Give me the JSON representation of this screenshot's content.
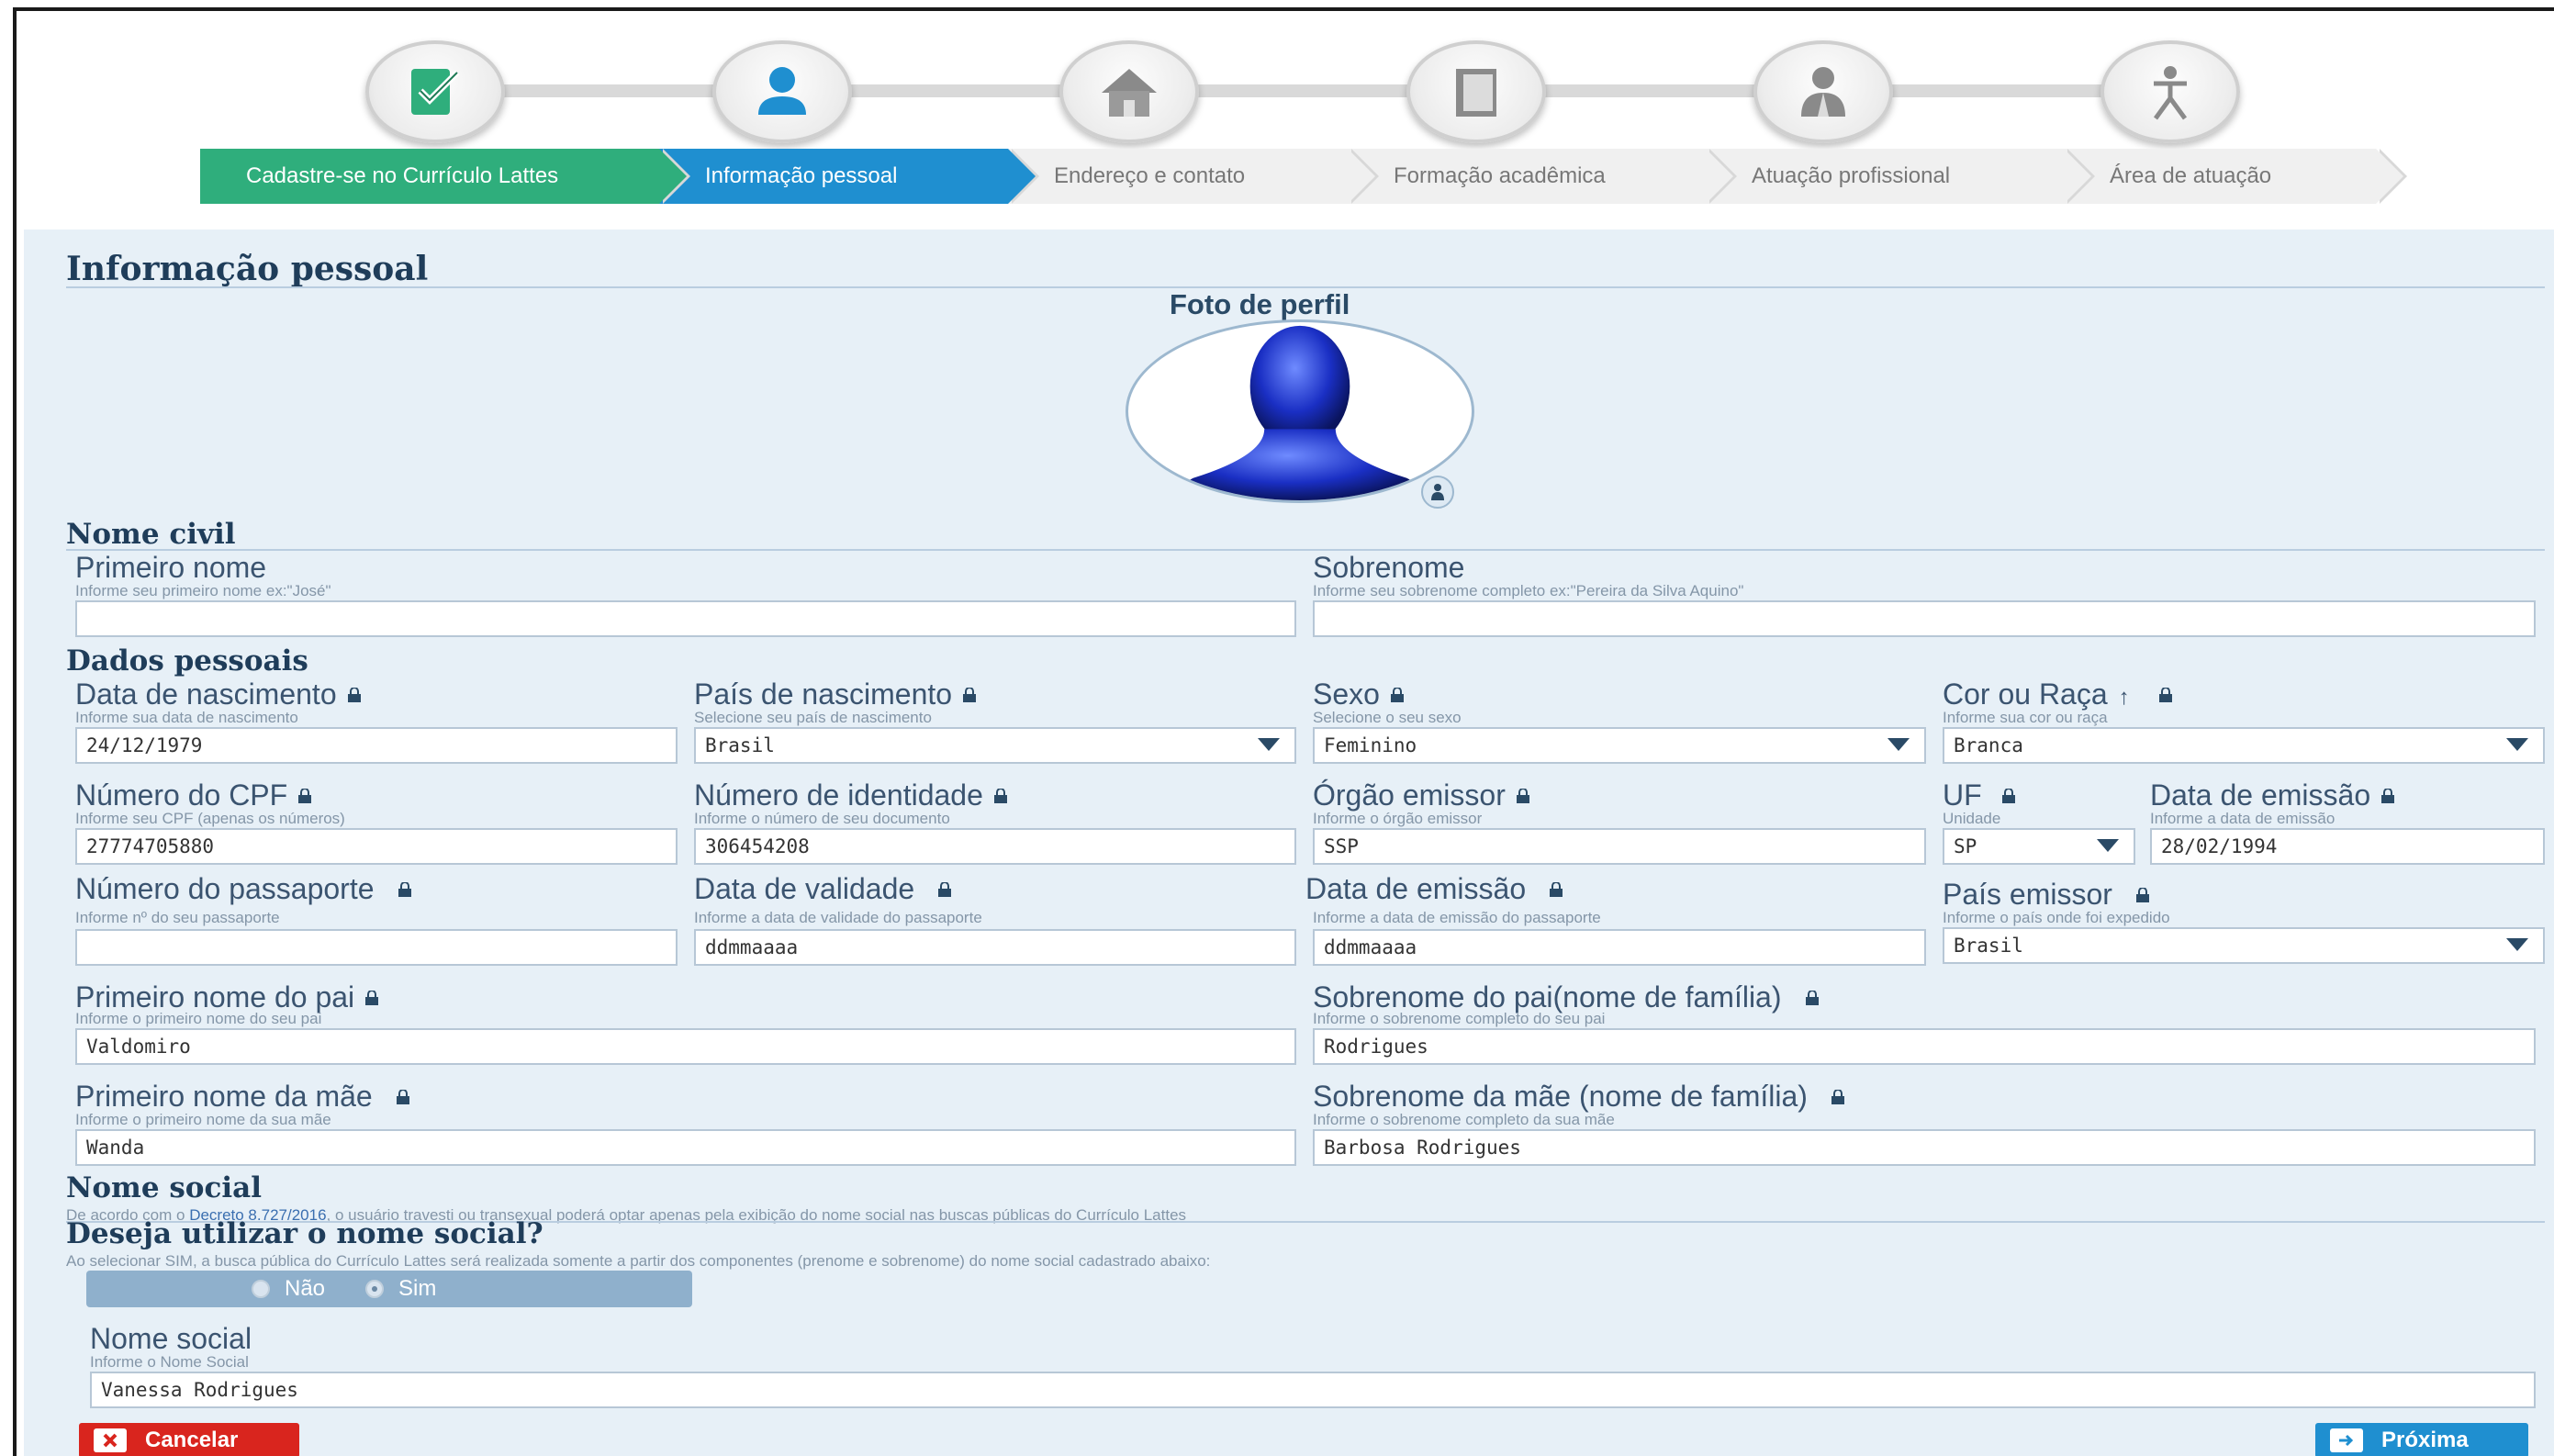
{
  "wizard": {
    "steps": [
      {
        "label": "Cadastre-se no Currículo Lattes",
        "icon": "checklist-icon",
        "state": "done"
      },
      {
        "label": "Informação pessoal",
        "icon": "person-icon",
        "state": "active"
      },
      {
        "label": "Endereço e contato",
        "icon": "house-icon",
        "state": "pending"
      },
      {
        "label": "Formação acadêmica",
        "icon": "book-icon",
        "state": "pending"
      },
      {
        "label": "Atuação profissional",
        "icon": "professional-icon",
        "state": "pending"
      },
      {
        "label": "Área de atuação",
        "icon": "figure-icon",
        "state": "pending"
      }
    ],
    "colors": {
      "done": "#2fae7c",
      "active": "#1f8fd0",
      "pending": "#f0f0f0"
    }
  },
  "page": {
    "title": "Informação pessoal",
    "photo_label": "Foto de perfil"
  },
  "nome_civil": {
    "title": "Nome civil",
    "primeiro_nome": {
      "label": "Primeiro nome",
      "hint": "Informe seu primeiro nome ex:\"José\"",
      "value": ""
    },
    "sobrenome": {
      "label": "Sobrenome",
      "hint": "Informe seu sobrenome completo ex:\"Pereira da Silva Aquino\"",
      "value": ""
    }
  },
  "dados_pessoais": {
    "title": "Dados pessoais",
    "data_nascimento": {
      "label": "Data de nascimento",
      "hint": "Informe sua data de nascimento",
      "value": "24/12/1979"
    },
    "pais_nascimento": {
      "label": "País de nascimento",
      "hint": "Selecione seu país de nascimento",
      "value": "Brasil"
    },
    "sexo": {
      "label": "Sexo",
      "hint": "Selecione o seu sexo",
      "value": "Feminino"
    },
    "cor_raca": {
      "label": "Cor ou Raça",
      "hint": "Informe sua cor ou raça",
      "value": "Branca"
    },
    "cpf": {
      "label": "Número do CPF",
      "hint": "Informe seu CPF (apenas os números)",
      "value": "27774705880"
    },
    "identidade": {
      "label": "Número de identidade",
      "hint": "Informe o número de seu documento",
      "value": "306454208"
    },
    "orgao_emissor": {
      "label": "Órgão emissor",
      "hint": "Informe o órgão emissor",
      "value": "SSP"
    },
    "uf": {
      "label": "UF",
      "hint": "Unidade",
      "value": "SP"
    },
    "data_emissao": {
      "label": "Data de emissão",
      "hint": "Informe a data de emissão",
      "value": "28/02/1994"
    },
    "passaporte": {
      "label": "Número do passaporte",
      "hint": "Informe nº do seu passaporte",
      "value": ""
    },
    "data_validade": {
      "label": "Data de validade",
      "hint": "Informe a data de validade do passaporte",
      "value": "ddmmaaaa"
    },
    "data_emissao_passaporte": {
      "label": "Data de emissão",
      "hint": "Informe a data de emissão do passaporte",
      "value": "ddmmaaaa"
    },
    "pais_emissor": {
      "label": "País emissor",
      "hint": "Informe o país onde foi expedido",
      "value": "Brasil"
    },
    "pai_nome": {
      "label": "Primeiro nome do pai",
      "hint": "Informe o primeiro nome do seu pai",
      "value": "Valdomiro"
    },
    "pai_sobrenome": {
      "label": "Sobrenome do pai(nome de família)",
      "hint": "Informe o sobrenome completo do seu pai",
      "value": "Rodrigues"
    },
    "mae_nome": {
      "label": "Primeiro nome da mãe",
      "hint": "Informe o primeiro nome da sua mãe",
      "value": "Wanda"
    },
    "mae_sobrenome": {
      "label": "Sobrenome da mãe (nome de família)",
      "hint": "Informe o sobrenome completo da sua mãe",
      "value": "Barbosa Rodrigues"
    }
  },
  "nome_social": {
    "title": "Nome social",
    "notice_prefix": "De acordo com o",
    "notice_link": "Decreto 8.727/2016",
    "notice_suffix": ", o usuário travesti ou transexual poderá optar apenas pela exibição do nome social nas buscas públicas do Currículo Lattes",
    "question": "Deseja utilizar o nome social?",
    "question_hint": "Ao selecionar SIM, a busca pública do Currículo Lattes será realizada somente a partir dos componentes (prenome e sobrenome) do nome social cadastrado abaixo:",
    "option_no": "Não",
    "option_yes": "Sim",
    "field": {
      "label": "Nome social",
      "hint": "Informe o Nome Social",
      "value": "Vanessa Rodrigues"
    }
  },
  "actions": {
    "cancel": "Cancelar",
    "next": "Próxima"
  }
}
